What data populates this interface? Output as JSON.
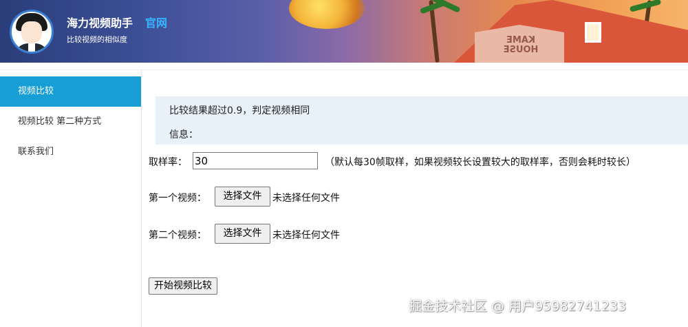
{
  "header": {
    "title": "海力视频助手",
    "official_link": "官网",
    "subtitle": "比较视频的相似度",
    "banner_sign": "KAME HOUSE"
  },
  "sidebar": {
    "items": [
      {
        "label": "视频比较",
        "active": true
      },
      {
        "label": "视频比较 第二种方式",
        "active": false
      },
      {
        "label": "联系我们",
        "active": false
      }
    ]
  },
  "info": {
    "line1": "比较结果超过0.9，判定视频相同",
    "line2": "信息："
  },
  "form": {
    "rate_label": "取样率：",
    "rate_value": "30",
    "rate_hint": "（默认每30帧取样，如果视频较长设置较大的取样率，否则会耗时较长）",
    "video1_label": "第一个视频：",
    "video2_label": "第二个视频：",
    "choose_file_label": "选择文件",
    "no_file_text": "未选择任何文件",
    "start_button": "开始视频比较"
  },
  "watermark": "掘金技术社区 @ 用户95982741233",
  "colors": {
    "accent": "#179fd5",
    "link": "#38b4ff",
    "info_bg": "#e8f0f8"
  }
}
